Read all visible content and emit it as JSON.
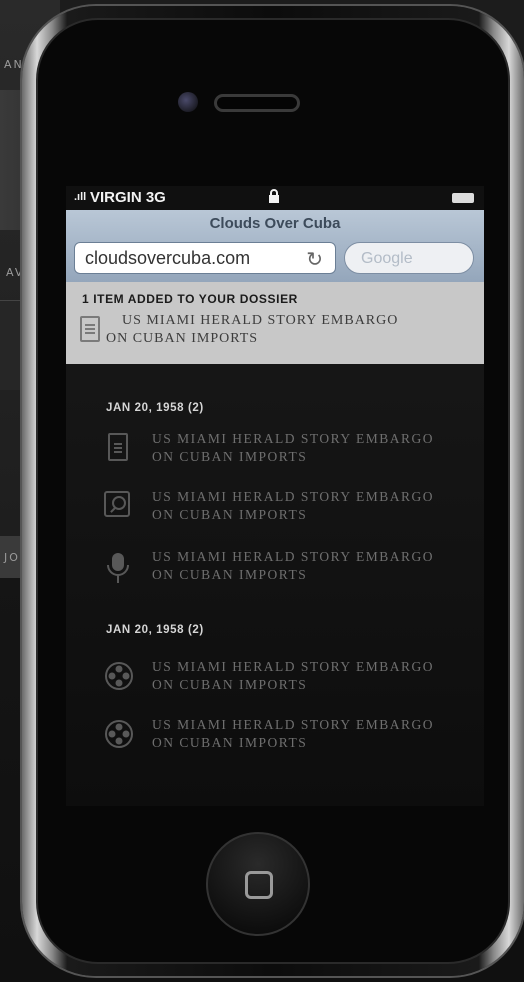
{
  "background": {
    "text_top": "AN",
    "text_mid": "AV",
    "text_bottom": "JOI"
  },
  "status_bar": {
    "signal": ".ıll",
    "carrier": "VIRGIN  3G"
  },
  "browser": {
    "page_title": "Clouds Over Cuba",
    "url": "cloudsovercuba.com",
    "search_placeholder": "Google"
  },
  "notice": {
    "title": "1 ITEM ADDED TO YOUR DOSSIER",
    "item_line1": "US MIAMI HERALD STORY EMBARGO",
    "item_line2": "ON CUBAN IMPORTS"
  },
  "sections": [
    {
      "date": "JAN 20, 1958 (2)",
      "items": [
        {
          "icon": "document-icon",
          "line1": "US MIAMI HERALD STORY EMBARGO",
          "line2": "ON CUBAN IMPORTS"
        },
        {
          "icon": "search-icon",
          "line1": "US MIAMI HERALD STORY EMBARGO",
          "line2": "ON CUBAN IMPORTS"
        },
        {
          "icon": "microphone-icon",
          "line1": "US MIAMI HERALD STORY EMBARGO",
          "line2": "ON CUBAN IMPORTS"
        }
      ]
    },
    {
      "date": "JAN 20, 1958 (2)",
      "items": [
        {
          "icon": "film-reel-icon",
          "line1": "US MIAMI HERALD STORY EMBARGO",
          "line2": "ON CUBAN IMPORTS"
        },
        {
          "icon": "film-reel-icon",
          "line1": "US MIAMI HERALD STORY EMBARGO",
          "line2": "ON CUBAN IMPORTS"
        }
      ]
    }
  ],
  "colors": {
    "browser_bar": "#a7b7c9",
    "notice_bg": "#c8c8c8",
    "screen_bg": "#121212",
    "item_text": "#6f6f6f"
  }
}
